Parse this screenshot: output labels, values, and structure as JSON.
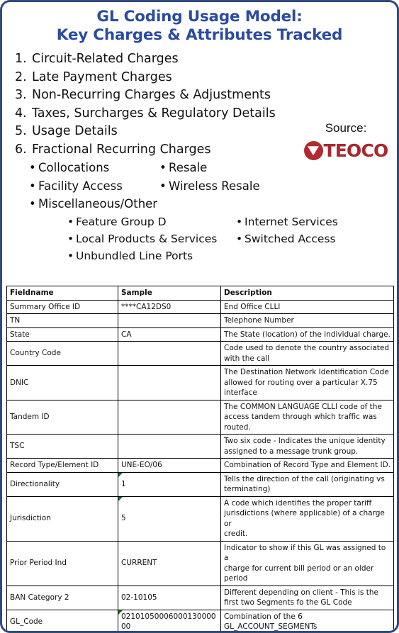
{
  "slide": {
    "title_lines": [
      "GL Coding Usage Model:",
      "Key Charges & Attributes Tracked"
    ],
    "title_color": "#2b4ba2",
    "border_color": "#2f4a7c"
  },
  "numbered_list": [
    {
      "num": "1.",
      "text": "Circuit-Related Charges"
    },
    {
      "num": "2.",
      "text": "Late Payment Charges"
    },
    {
      "num": "3.",
      "text": "Non-Recurring Charges & Adjustments"
    },
    {
      "num": "4.",
      "text": "Taxes, Surcharges & Regulatory Details"
    },
    {
      "num": "5.",
      "text": "Usage Details"
    },
    {
      "num": "6.",
      "text": "Fractional Recurring Charges"
    }
  ],
  "sub_bullets": [
    {
      "left": "Collocations",
      "right": "Resale"
    },
    {
      "left": "Facility Access",
      "right": "Wireless Resale"
    },
    {
      "left": "Miscellaneous/Other",
      "right": ""
    }
  ],
  "sub_bullets_level3": [
    {
      "left": "Feature Group D",
      "right": "Internet Services"
    },
    {
      "left": "Local Products & Services",
      "right": "Switched Access"
    },
    {
      "left": "Unbundled Line Ports",
      "right": ""
    }
  ],
  "source": {
    "label": "Source:",
    "logo_text": "TEOCO",
    "logo_color": "#a82830",
    "logo_mark_icon": "teoco-triangle-badge-icon"
  },
  "table": {
    "headers": [
      "Fieldname",
      "Sample",
      "Description"
    ],
    "rows": [
      {
        "fieldname": "Summary Office ID",
        "sample": "****CA12DS0",
        "flagged": false,
        "description": [
          "End Office CLLI"
        ]
      },
      {
        "fieldname": "TN",
        "sample": "",
        "flagged": false,
        "description": [
          "Telephone Number"
        ]
      },
      {
        "fieldname": "State",
        "sample": "CA",
        "flagged": false,
        "description": [
          "The State (location) of the individual charge."
        ]
      },
      {
        "fieldname": "Country Code",
        "sample": "",
        "flagged": false,
        "description": [
          "Code used to denote the country associated",
          "with the call"
        ]
      },
      {
        "fieldname": "DNIC",
        "sample": "",
        "flagged": false,
        "description": [
          "The Destination Network Identification Code",
          "allowed for routing over a particular X.75",
          "interface"
        ]
      },
      {
        "fieldname": "Tandem ID",
        "sample": "",
        "flagged": false,
        "description": [
          "The COMMON LANGUAGE CLLI code of the",
          "access tandem through which traffic was",
          "routed."
        ]
      },
      {
        "fieldname": "TSC",
        "sample": "",
        "flagged": false,
        "description": [
          "Two six code - Indicates the unique identity",
          "assigned to a message trunk group."
        ]
      },
      {
        "fieldname": "Record Type/Element ID",
        "sample": "UNE-EO/06",
        "flagged": false,
        "description": [
          "Combination of Record Type and Element ID."
        ]
      },
      {
        "fieldname": "Directionality",
        "sample": "1",
        "flagged": true,
        "description": [
          "Tells the direction of the call (originating vs",
          "terminating)"
        ]
      },
      {
        "fieldname": "Jurisdiction",
        "sample": "5",
        "flagged": true,
        "description": [
          "A code which identifies the proper tariff",
          "jurisdictions (where applicable) of a charge or",
          "credit."
        ]
      },
      {
        "fieldname": "Prior Period Ind",
        "sample": "CURRENT",
        "flagged": false,
        "description": [
          "Indicator to show if this GL was assigned to a",
          "charge for current bill period or an older",
          "period"
        ]
      },
      {
        "fieldname": "BAN Category 2",
        "sample": "02-10105",
        "flagged": false,
        "description": [
          "Different depending on client - This is the",
          "first two Segments fo the GL Code"
        ]
      },
      {
        "fieldname": "GL_Code",
        "sample": "0210105000600013000000",
        "flagged": true,
        "description": [
          "Combination of the 6",
          "GL_ACCOUNT_SEGMENTs"
        ]
      }
    ]
  }
}
